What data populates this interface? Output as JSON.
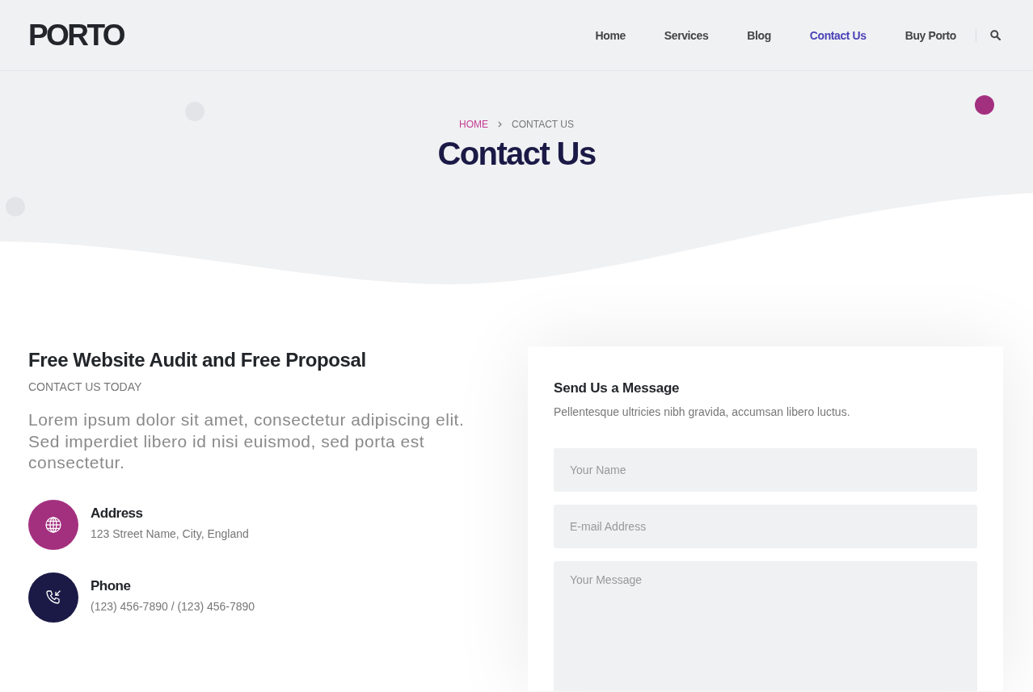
{
  "header": {
    "logo": "PORTO",
    "nav": [
      {
        "label": "Home",
        "selected": false
      },
      {
        "label": "Services",
        "selected": false
      },
      {
        "label": "Blog",
        "selected": false
      },
      {
        "label": "Contact Us",
        "selected": true
      },
      {
        "label": "Buy Porto",
        "selected": false
      }
    ]
  },
  "hero": {
    "breadcrumb": [
      "HOME",
      "CONTACT US"
    ],
    "title": "Contact Us"
  },
  "intro": {
    "heading": "Free Website Audit and Free Proposal",
    "subheading": "CONTACT US TODAY",
    "text": "Lorem ipsum dolor sit amet, consectetur adipiscing elit. Sed imperdiet libero id nisi euismod, sed porta est consectetur."
  },
  "contacts": [
    {
      "kind": "address",
      "title": "Address",
      "text": "123 Street Name, City, England",
      "color": "#a3307f"
    },
    {
      "kind": "phone",
      "title": "Phone",
      "text": "(123) 456-7890 / (123) 456-7890",
      "color": "#1b1a46"
    }
  ],
  "form": {
    "title": "Send Us a Message",
    "text": "Pellentesque ultricies nibh gravida, accumsan libero luctus.",
    "fields": [
      {
        "kind": "input",
        "placeholder": "Your Name"
      },
      {
        "kind": "input",
        "placeholder": "E-mail Address"
      },
      {
        "kind": "textarea",
        "placeholder": "Your Message"
      }
    ]
  }
}
